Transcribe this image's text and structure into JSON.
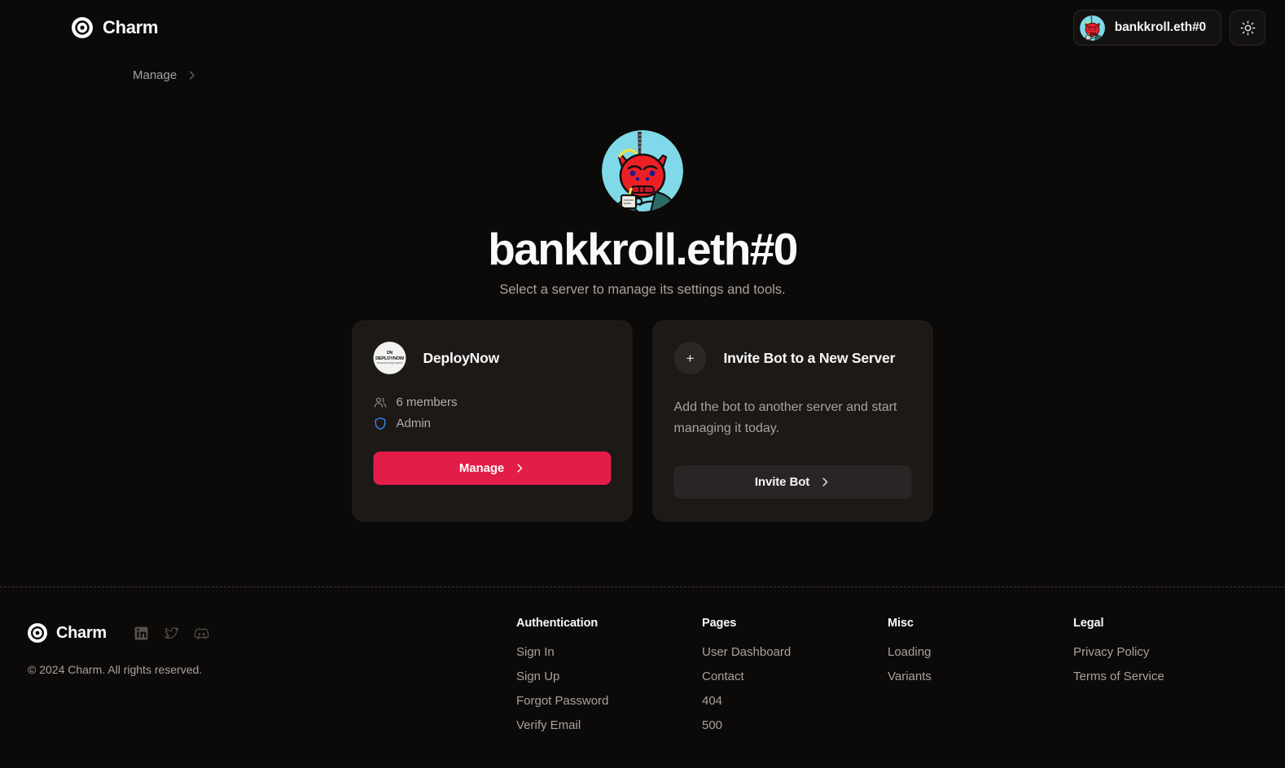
{
  "colors": {
    "page_bg": "#0c0a09",
    "card_bg": "#1c1917",
    "accent": "#e11d48",
    "shield_blue": "#3b82f6",
    "muted_text": "#a8a29e"
  },
  "header": {
    "brand_name": "Charm",
    "brand_icon": "target-logo-icon",
    "user_chip": {
      "name": "bankkroll.eth#0",
      "avatar_icon": "demon-avatar"
    },
    "theme_toggle_icon": "sun-icon"
  },
  "breadcrumb": {
    "items": [
      {
        "label": "Manage"
      }
    ],
    "separator_icon": "chevron-right-icon"
  },
  "hero": {
    "avatar_icon": "demon-avatar",
    "title": "bankkroll.eth#0",
    "subtitle": "Select a server to manage its settings and tools."
  },
  "cards": [
    {
      "id": "deploynow",
      "avatar": {
        "line1": "DN",
        "line2": "DEPLOYNOW",
        "line3": "Production Ready Starters"
      },
      "title": "DeployNow",
      "meta": [
        {
          "icon": "users-icon",
          "text": "6 members"
        },
        {
          "icon": "shield-icon",
          "text": "Admin"
        }
      ],
      "button": {
        "label": "Manage",
        "icon": "chevron-right-icon",
        "style": "primary"
      }
    },
    {
      "id": "invite-bot",
      "avatar_glyph": "+",
      "title": "Invite Bot to a New Server",
      "description": "Add the bot to another server and start managing it today.",
      "button": {
        "label": "Invite Bot",
        "icon": "chevron-right-icon",
        "style": "secondary"
      }
    }
  ],
  "footer": {
    "brand_name": "Charm",
    "brand_icon": "target-logo-icon",
    "socials": [
      {
        "name": "linkedin-icon"
      },
      {
        "name": "twitter-icon"
      },
      {
        "name": "discord-icon"
      }
    ],
    "copyright": "© 2024 Charm. All rights reserved.",
    "columns": [
      {
        "heading": "Authentication",
        "links": [
          "Sign In",
          "Sign Up",
          "Forgot Password",
          "Verify Email"
        ]
      },
      {
        "heading": "Pages",
        "links": [
          "User Dashboard",
          "Contact",
          "404",
          "500"
        ]
      },
      {
        "heading": "Misc",
        "links": [
          "Loading",
          "Variants"
        ]
      },
      {
        "heading": "Legal",
        "links": [
          "Privacy Policy",
          "Terms of Service"
        ]
      }
    ]
  }
}
